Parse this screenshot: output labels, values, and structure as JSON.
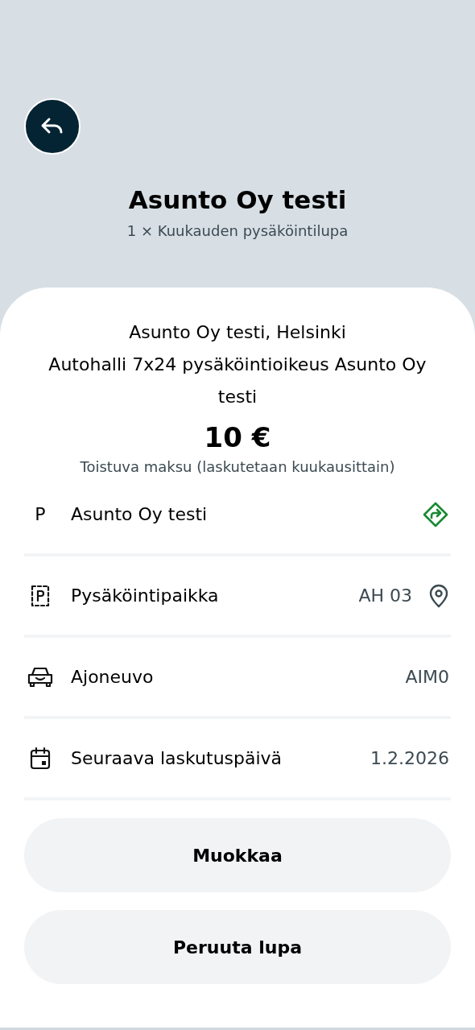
{
  "header": {
    "title": "Asunto Oy testi",
    "subtitle": "1 × Kuukauden pysäköintilupa"
  },
  "summary": {
    "lines": [
      "Asunto Oy testi, Helsinki",
      "Autohalli 7x24 pysäköintioikeus Asunto Oy testi"
    ],
    "price": "10 €",
    "note": "Toistuva maksu (laskutetaan kuukausittain)"
  },
  "rows": [
    {
      "kind": "parking",
      "glyph": "P",
      "label": "Asunto Oy testi"
    },
    {
      "kind": "spot",
      "label": "Pysäköintipaikka",
      "value": "AH 03"
    },
    {
      "kind": "vehicle",
      "label": "Ajoneuvo",
      "value": "AIM0"
    },
    {
      "kind": "date",
      "label": "Seuraava laskutuspäivä",
      "value": "1.2.2026"
    }
  ],
  "buttons": [
    "Muokkaa",
    "Peruuta lupa"
  ]
}
